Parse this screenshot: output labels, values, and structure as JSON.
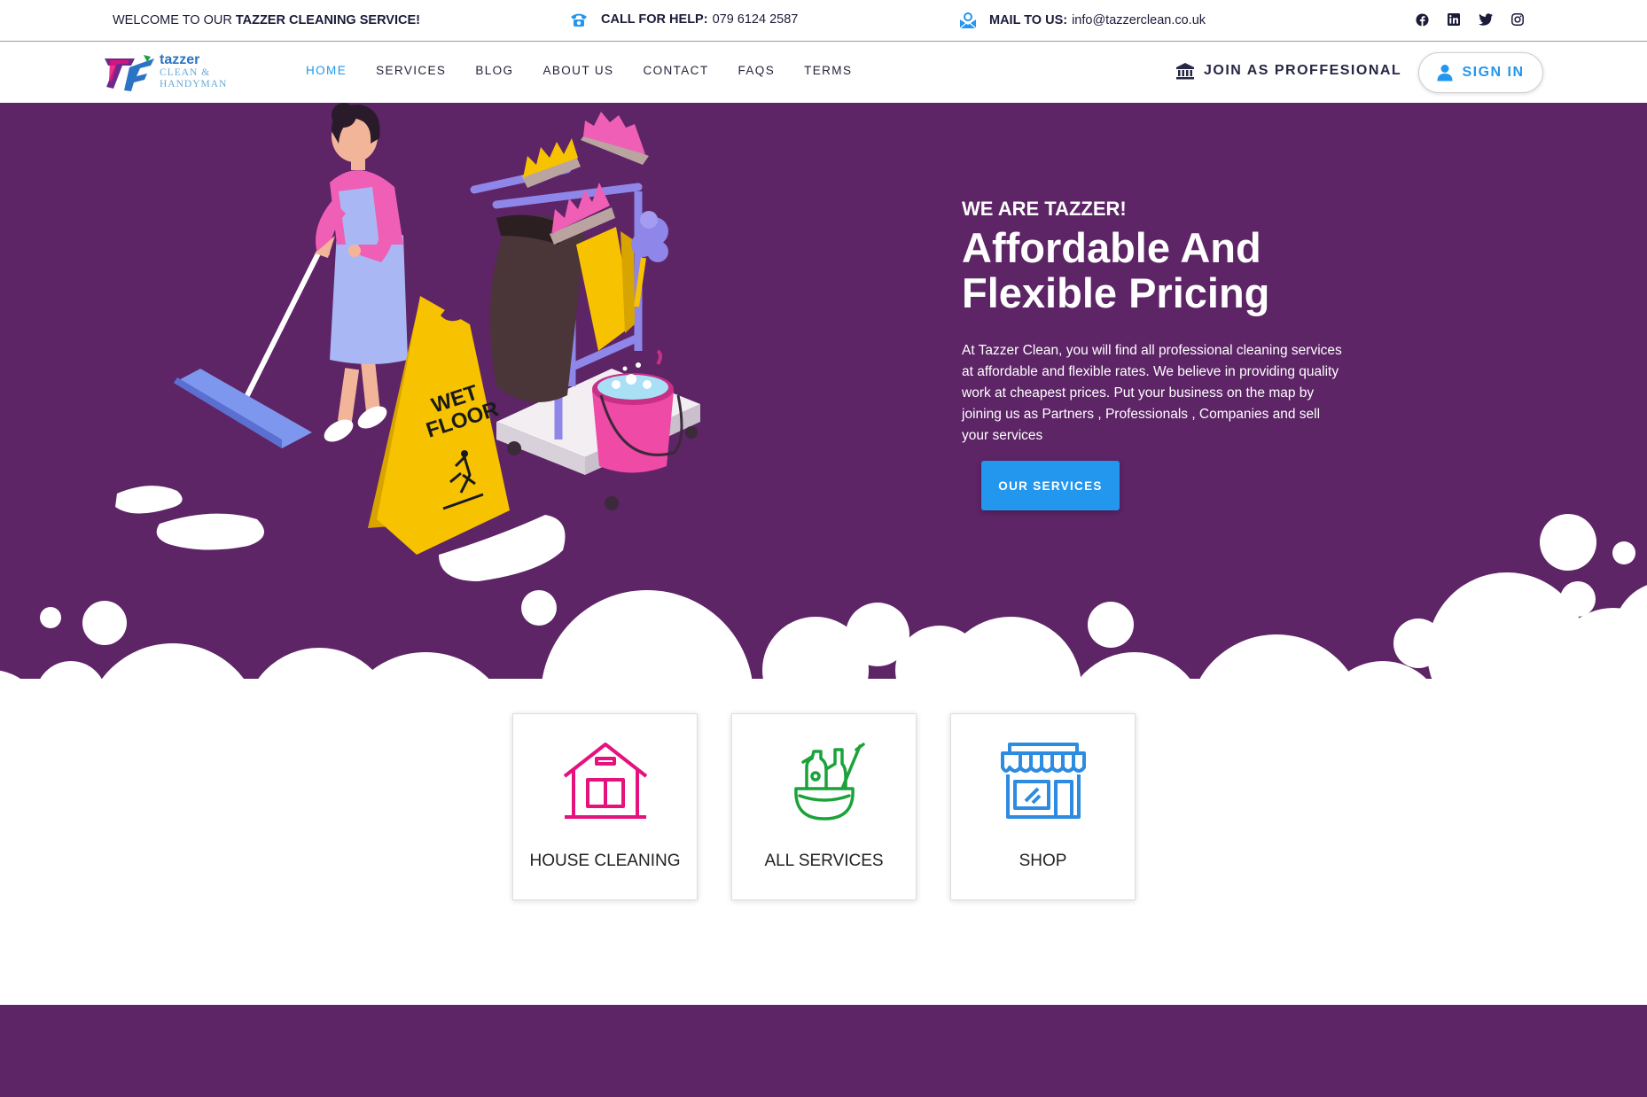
{
  "topbar": {
    "welcome_prefix": "WELCOME TO OUR ",
    "welcome_bold": "TAZZER CLEANING SERVICE!",
    "call_label": "CALL FOR HELP:",
    "call_value": "079 6124 2587",
    "mail_label": "MAIL TO US:",
    "mail_value": "info@tazzerclean.co.uk",
    "social_icons": [
      "facebook-icon",
      "linkedin-icon",
      "twitter-icon",
      "instagram-icon"
    ]
  },
  "logo": {
    "line1": "tazzer",
    "line2": "CLEAN &",
    "line3": "HANDYMAN"
  },
  "nav": {
    "items": [
      {
        "label": "HOME",
        "active": true
      },
      {
        "label": "SERVICES",
        "active": false
      },
      {
        "label": "BLOG",
        "active": false
      },
      {
        "label": "ABOUT US",
        "active": false
      },
      {
        "label": "CONTACT",
        "active": false
      },
      {
        "label": "FAQS",
        "active": false
      },
      {
        "label": "TERMS",
        "active": false
      }
    ],
    "join_label": "JOIN AS PROFFESIONAL",
    "signin_label": "SIGN IN"
  },
  "hero": {
    "kicker": "WE ARE TAZZER!",
    "title": "Affordable And Flexible Pricing",
    "text": "At Tazzer Clean, you will find all professional cleaning services at affordable and flexible rates. We believe in providing quality work at cheapest prices. Put your business on the map by joining us as Partners , Professionals , Companies and sell your services",
    "button_label": "OUR SERVICES",
    "sign_text_1": "WET",
    "sign_text_2": "FLOOR"
  },
  "cards": [
    {
      "label": "HOUSE CLEANING",
      "icon": "house-icon"
    },
    {
      "label": "ALL SERVICES",
      "icon": "cleaning-supplies-icon"
    },
    {
      "label": "SHOP",
      "icon": "shop-icon"
    }
  ],
  "colors": {
    "brand_purple": "#5d2466",
    "accent_blue": "#2397ee",
    "house_pink": "#e5127d",
    "services_green": "#1aa33a",
    "shop_blue": "#2d8be0"
  }
}
